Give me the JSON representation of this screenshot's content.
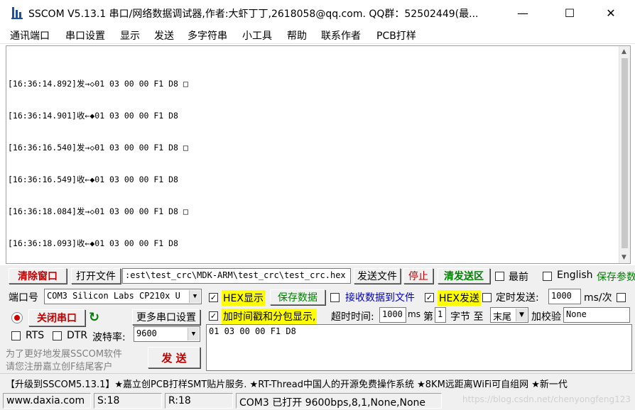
{
  "window": {
    "title": "SSCOM V5.13.1 串口/网络数据调试器,作者:大虾丁丁,2618058@qq.com. QQ群：52502449(最...",
    "minimize": "—",
    "maximize": "☐",
    "close": "✕"
  },
  "menu": [
    "通讯端口",
    "串口设置",
    "显示",
    "发送",
    "多字符串",
    "小工具",
    "帮助",
    "联系作者",
    "PCB打样"
  ],
  "receive_lines": [
    "[16:36:14.892]发→◇01 03 00 00 F1 D8 □",
    "[16:36:14.901]收←◆01 03 00 00 F1 D8",
    "[16:36:16.540]发→◇01 03 00 00 F1 D8 □",
    "[16:36:16.549]收←◆01 03 00 00 F1 D8",
    "[16:36:18.084]发→◇01 03 00 00 F1 D8 □",
    "[16:36:18.093]收←◆01 03 00 00 F1 D8"
  ],
  "toolbar": {
    "clear_window": "清除窗口",
    "open_file": "打开文件",
    "file_path": ":est\\test_crc\\MDK-ARM\\test_crc\\test_crc.hex",
    "send_file": "发送文件",
    "stop": "停止",
    "clear_send": "清发送区",
    "latest": "最前",
    "english": "English",
    "save_params": "保存参数"
  },
  "port": {
    "label": "端口号",
    "value": "COM3 Silicon Labs CP210x U",
    "close_port": "关闭串口",
    "more_settings": "更多串口设置",
    "rts": "RTS",
    "dtr": "DTR",
    "baud_label": "波特率:",
    "baud_value": "9600"
  },
  "options": {
    "hex_display": "HEX显示",
    "save_data": "保存数据",
    "recv_to_file": "接收数据到文件",
    "hex_send": "HEX发送",
    "timed_send": "定时发送:",
    "timed_value": "1000",
    "timed_unit": "ms/次",
    "timestamp": "加时间戳和分包显示,",
    "timeout_label": "超时时间:",
    "timeout_value": "1000",
    "timeout_unit": "ms",
    "nth_label": "第",
    "nth_value": "1",
    "byte_label": "字节 至",
    "end_value": "末尾",
    "checksum_label": "加校验",
    "checksum_value": "None"
  },
  "send_area": {
    "text": "01 03 00 00 F1 D8",
    "notice_line1": "为了更好地发展SSCOM软件",
    "notice_line2": "请您注册嘉立创F结尾客户",
    "send_button": "发  送"
  },
  "ticker": "【升级到SSCOM5.13.1】★嘉立创PCB打样SMT贴片服务. ★RT-Thread中国人的开源免费操作系统 ★8KM远距离WiFi可自组网 ★新一代",
  "status": {
    "website": "www.daxia.com",
    "sent": "S:18",
    "received": "R:18",
    "port_status": "COM3 已打开  9600bps,8,1,None,None",
    "watermark": "https://blog.csdn.net/chenyongfeng123"
  },
  "colors": {
    "red_text": "#c00000",
    "green_text": "#008000",
    "blue_text": "#0000c0",
    "highlight": "#ffff00"
  }
}
